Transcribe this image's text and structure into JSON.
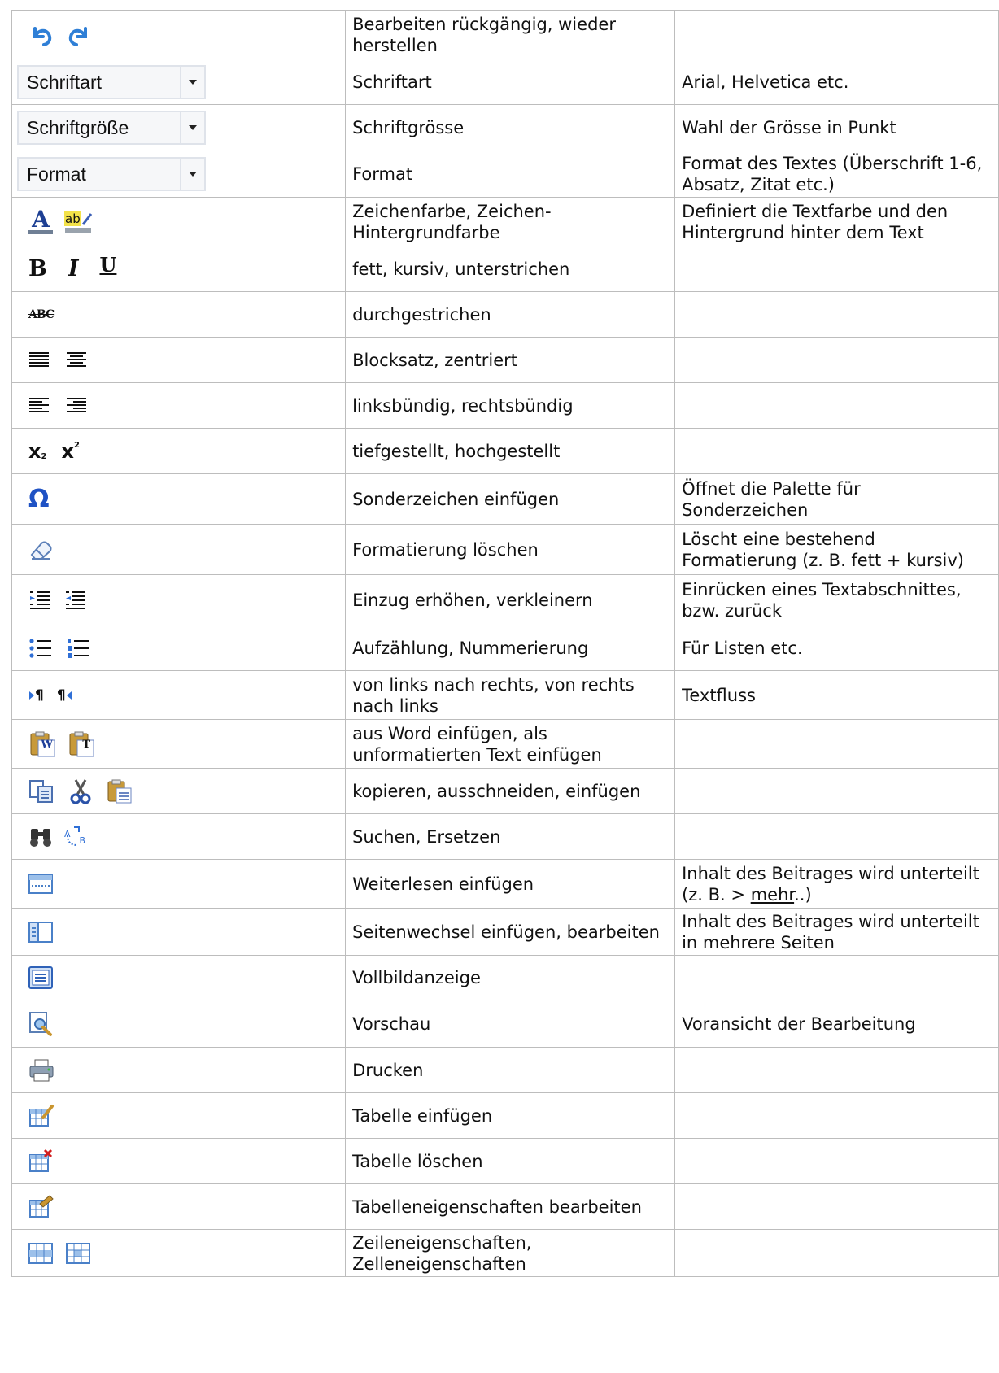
{
  "rows": [
    {
      "icons": [
        "undo-icon",
        "redo-icon"
      ],
      "function": "Bearbeiten rückgängig, wieder herstellen",
      "description": ""
    },
    {
      "dropdown": "Schriftart",
      "function": "Schriftart",
      "description": "Arial, Helvetica etc."
    },
    {
      "dropdown": "Schriftgröße",
      "function": "Schriftgrösse",
      "description": "Wahl der Grösse in Punkt"
    },
    {
      "dropdown": "Format",
      "function": "Format",
      "description": "Format des Textes (Überschrift 1-6, Absatz, Zitat etc.)"
    },
    {
      "icons": [
        "font-color-icon",
        "highlight-color-icon"
      ],
      "icon_text": [
        "A",
        "ab"
      ],
      "function": "Zeichenfarbe, Zeichen-Hintergrundfarbe",
      "description": "Definiert die Textfarbe und den Hintergrund hinter dem Text"
    },
    {
      "icons": [
        "bold-icon",
        "italic-icon",
        "underline-icon"
      ],
      "icon_text": [
        "B",
        "I",
        "U"
      ],
      "function": "fett, kursiv, unterstrichen",
      "description": ""
    },
    {
      "icons": [
        "strikethrough-icon"
      ],
      "icon_text": [
        "ABC"
      ],
      "function": "durchgestrichen",
      "description": ""
    },
    {
      "icons": [
        "justify-icon",
        "align-center-icon"
      ],
      "function": "Blocksatz, zentriert",
      "description": ""
    },
    {
      "icons": [
        "align-left-icon",
        "align-right-icon"
      ],
      "function": "linksbündig, rechtsbündig",
      "description": ""
    },
    {
      "icons": [
        "subscript-icon",
        "superscript-icon"
      ],
      "icon_text": [
        "x",
        "2",
        "x",
        "2"
      ],
      "function": "tiefgestellt, hochgestellt",
      "description": ""
    },
    {
      "icons": [
        "omega-icon"
      ],
      "icon_text": [
        "Ω"
      ],
      "function": "Sonderzeichen einfügen",
      "description": "Öffnet die Palette für Sonderzeichen"
    },
    {
      "icons": [
        "eraser-icon"
      ],
      "function": "Formatierung löschen",
      "description": "Löscht eine bestehend Formatierung (z. B. fett + kursiv)"
    },
    {
      "icons": [
        "indent-icon",
        "outdent-icon"
      ],
      "function": "Einzug erhöhen, verkleinern",
      "description": "Einrücken eines Textabschnittes, bzw. zurück"
    },
    {
      "icons": [
        "bullet-list-icon",
        "numbered-list-icon"
      ],
      "function": "Aufzählung, Nummerierung",
      "description": "Für Listen etc."
    },
    {
      "icons": [
        "ltr-icon",
        "rtl-icon"
      ],
      "icon_text": [
        "¶",
        "¶"
      ],
      "function": "von links nach rechts, von rechts nach links",
      "description": "Textfluss"
    },
    {
      "icons": [
        "paste-word-icon",
        "paste-text-icon"
      ],
      "icon_text": [
        "W",
        "T"
      ],
      "function": "aus Word einfügen, als unformatierten Text einfügen",
      "description": ""
    },
    {
      "icons": [
        "copy-icon",
        "cut-icon",
        "paste-icon"
      ],
      "function": "kopieren, ausschneiden, einfügen",
      "description": ""
    },
    {
      "icons": [
        "find-icon",
        "replace-icon"
      ],
      "icon_text": [
        "A",
        "B"
      ],
      "function": "Suchen, Ersetzen",
      "description": ""
    },
    {
      "icons": [
        "read-more-icon"
      ],
      "function": "Weiterlesen einfügen",
      "description_pre": "Inhalt des Beitrages wird unterteilt (z. B. > ",
      "description_link": "mehr",
      "description_post": "..)"
    },
    {
      "icons": [
        "page-break-icon"
      ],
      "function": "Seitenwechsel einfügen, bearbeiten",
      "description": "Inhalt des Beitrages wird unterteilt in mehrere Seiten"
    },
    {
      "icons": [
        "fullscreen-icon"
      ],
      "function": "Vollbildanzeige",
      "description": ""
    },
    {
      "icons": [
        "preview-icon"
      ],
      "function": "Vorschau",
      "description": "Voransicht der Bearbeitung"
    },
    {
      "icons": [
        "print-icon"
      ],
      "function": "Drucken",
      "description": ""
    },
    {
      "icons": [
        "table-insert-icon"
      ],
      "function": "Tabelle einfügen",
      "description": ""
    },
    {
      "icons": [
        "table-delete-icon"
      ],
      "function": "Tabelle löschen",
      "description": ""
    },
    {
      "icons": [
        "table-properties-icon"
      ],
      "function": "Tabelleneigenschaften bearbeiten",
      "description": ""
    },
    {
      "icons": [
        "row-properties-icon",
        "cell-properties-icon"
      ],
      "function": "Zeileneigenschaften, Zelleneigenschaften",
      "description": ""
    }
  ]
}
